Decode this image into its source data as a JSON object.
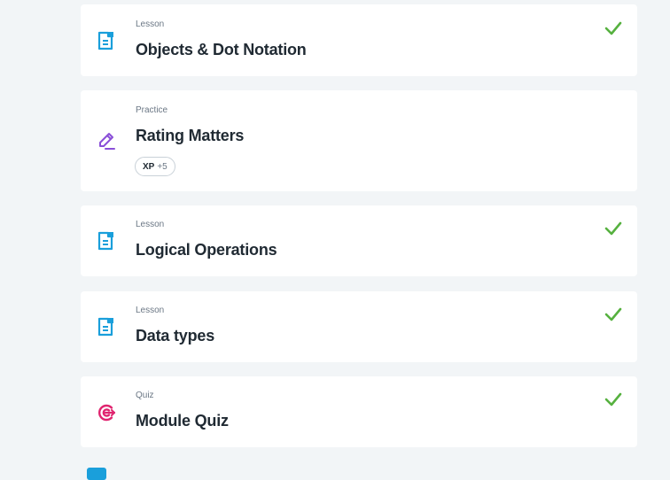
{
  "items": [
    {
      "kind": "Lesson",
      "title": "Objects & Dot Notation",
      "completed": true,
      "icon": "lesson-icon"
    },
    {
      "kind": "Practice",
      "title": "Rating Matters",
      "completed": false,
      "icon": "pencil-icon",
      "xp_label": "XP",
      "xp_amount": "+5"
    },
    {
      "kind": "Lesson",
      "title": "Logical Operations",
      "completed": true,
      "icon": "lesson-icon"
    },
    {
      "kind": "Lesson",
      "title": "Data types",
      "completed": true,
      "icon": "lesson-icon"
    },
    {
      "kind": "Quiz",
      "title": "Module Quiz",
      "completed": true,
      "icon": "target-icon"
    }
  ],
  "colors": {
    "lesson_icon": "#1a9fdb",
    "practice_icon": "#8a4fd8",
    "quiz_icon": "#e0246f",
    "check": "#56b13f",
    "background": "#f2f5f7"
  }
}
